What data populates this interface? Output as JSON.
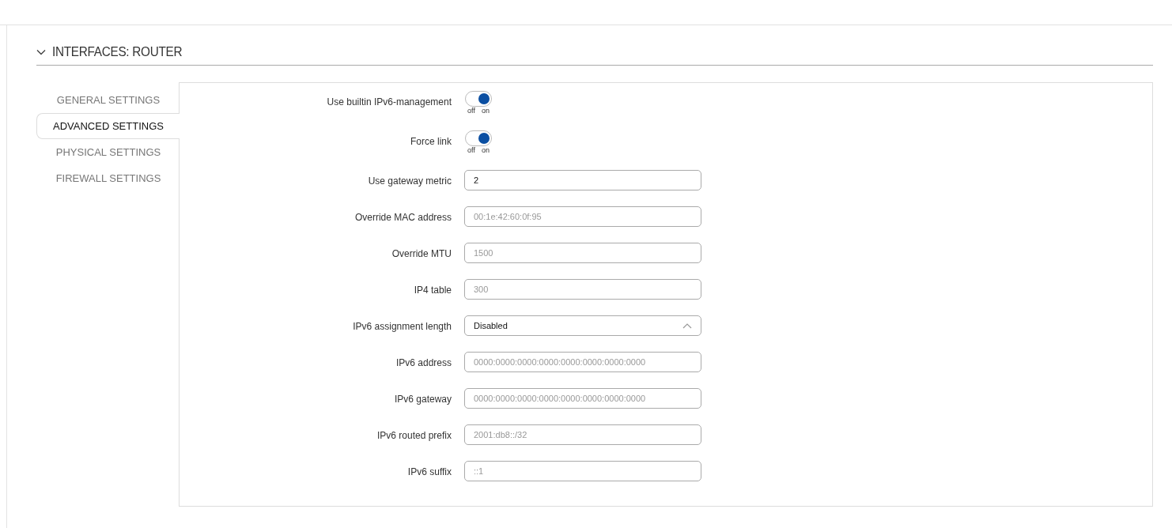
{
  "section": {
    "title": "INTERFACES: ROUTER",
    "expanded": true
  },
  "tabs": [
    {
      "label": "GENERAL SETTINGS",
      "selected": false
    },
    {
      "label": "ADVANCED SETTINGS",
      "selected": true
    },
    {
      "label": "PHYSICAL SETTINGS",
      "selected": false
    },
    {
      "label": "FIREWALL SETTINGS",
      "selected": false
    }
  ],
  "fields": [
    {
      "kind": "toggle",
      "label": "Use builtin IPv6-management",
      "on": true,
      "off_label": "off",
      "on_label": "on"
    },
    {
      "kind": "toggle",
      "label": "Force link",
      "on": true,
      "off_label": "off",
      "on_label": "on"
    },
    {
      "kind": "input",
      "label": "Use gateway metric",
      "value": "2"
    },
    {
      "kind": "input",
      "label": "Override MAC address",
      "placeholder": "00:1e:42:60:0f:95"
    },
    {
      "kind": "input",
      "label": "Override MTU",
      "placeholder": "1500"
    },
    {
      "kind": "input",
      "label": "IP4 table",
      "placeholder": "300"
    },
    {
      "kind": "select",
      "label": "IPv6 assignment length",
      "value": "Disabled",
      "expanded": true
    },
    {
      "kind": "input",
      "label": "IPv6 address",
      "placeholder": "0000:0000:0000:0000:0000:0000:0000:0000"
    },
    {
      "kind": "input",
      "label": "IPv6 gateway",
      "placeholder": "0000:0000:0000:0000:0000:0000:0000:0000"
    },
    {
      "kind": "input",
      "label": "IPv6 routed prefix",
      "placeholder": "2001:db8::/32"
    },
    {
      "kind": "input",
      "label": "IPv6 suffix",
      "placeholder": "::1"
    }
  ]
}
